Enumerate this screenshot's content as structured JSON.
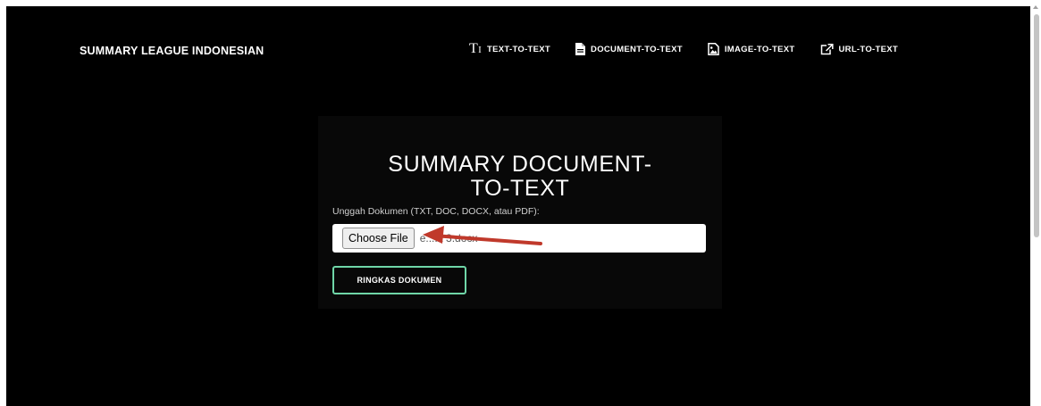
{
  "brand": "SUMMARY LEAGUE INDONESIAN",
  "nav": {
    "text_to_text": "TEXT-TO-TEXT",
    "document_to_text": "DOCUMENT-TO-TEXT",
    "image_to_text": "IMAGE-TO-TEXT",
    "url_to_text": "URL-TO-TEXT"
  },
  "card": {
    "title": "SUMMARY DOCUMENT-TO-TEXT",
    "upload_label": "Unggah Dokumen (TXT, DOC, DOCX, atau PDF):",
    "choose_file_label": "Choose File",
    "file_name": "e....k 3.docx",
    "submit_label": "RINGKAS DOKUMEN"
  },
  "colors": {
    "background": "#000000",
    "card": "#080808",
    "button_border": "#6fd6a8",
    "arrow": "#c0392b"
  }
}
